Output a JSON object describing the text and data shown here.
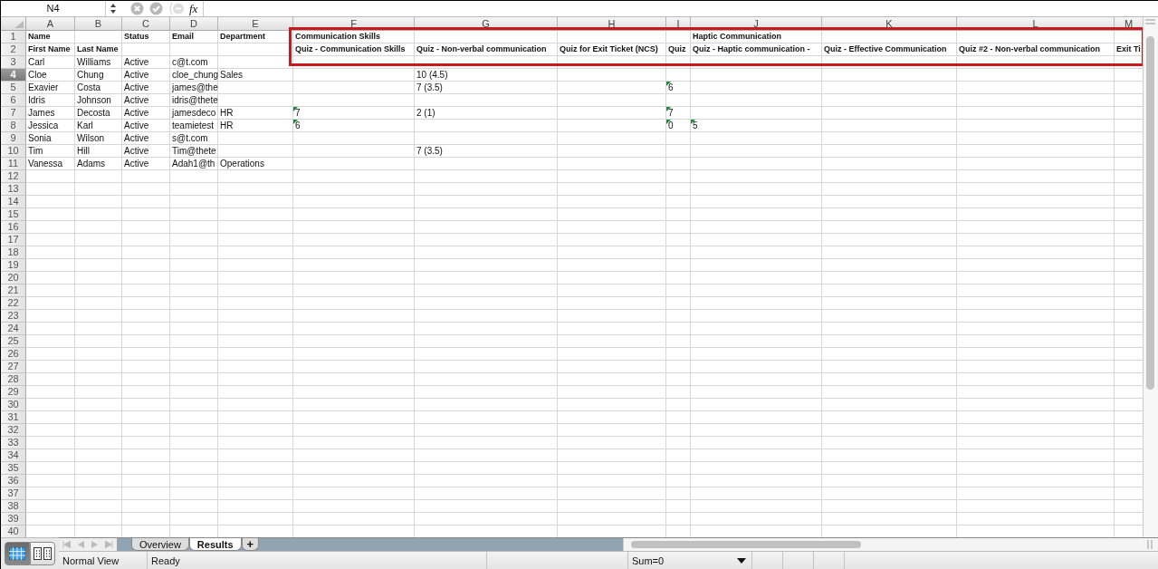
{
  "formula_bar": {
    "name_box": "N4",
    "fx": "fx"
  },
  "columns": [
    {
      "letter": "A"
    },
    {
      "letter": "B"
    },
    {
      "letter": "C"
    },
    {
      "letter": "D"
    },
    {
      "letter": "E"
    },
    {
      "letter": "F"
    },
    {
      "letter": "G"
    },
    {
      "letter": "H"
    },
    {
      "letter": "I"
    },
    {
      "letter": "J"
    },
    {
      "letter": "K"
    },
    {
      "letter": "L"
    },
    {
      "letter": "M"
    }
  ],
  "rows": [
    {
      "number": "1",
      "selected": false,
      "bold": true,
      "cells": {
        "A": {
          "text": "Name",
          "flagged": false
        },
        "C": {
          "text": "Status",
          "flagged": false
        },
        "D": {
          "text": "Email",
          "flagged": false
        },
        "E": {
          "text": "Department",
          "flagged": false
        },
        "F": {
          "text": "Communication Skills",
          "flagged": false
        },
        "J": {
          "text": "Haptic Communication",
          "flagged": false
        }
      }
    },
    {
      "number": "2",
      "selected": false,
      "bold": true,
      "cells": {
        "A": {
          "text": "First Name",
          "flagged": false
        },
        "B": {
          "text": "Last Name",
          "flagged": false
        },
        "F": {
          "text": "Quiz - Communication Skills",
          "flagged": false
        },
        "G": {
          "text": "Quiz - Non-verbal communication",
          "flagged": false
        },
        "H": {
          "text": "Quiz for Exit Ticket (NCS)",
          "flagged": false
        },
        "I": {
          "text": "Quiz",
          "flagged": false
        },
        "J": {
          "text": "Quiz - Haptic communication -",
          "flagged": false
        },
        "K": {
          "text": "Quiz - Effective Communication",
          "flagged": false
        },
        "L": {
          "text": "Quiz #2 - Non-verbal communication",
          "flagged": false
        },
        "M": {
          "text": "Exit Ti",
          "flagged": false
        }
      }
    },
    {
      "number": "3",
      "selected": false,
      "bold": false,
      "cells": {
        "A": {
          "text": "Carl",
          "flagged": false
        },
        "B": {
          "text": "Williams",
          "flagged": false
        },
        "C": {
          "text": "Active",
          "flagged": false
        },
        "D": {
          "text": "c@t.com",
          "flagged": false
        }
      }
    },
    {
      "number": "4",
      "selected": true,
      "bold": false,
      "cells": {
        "A": {
          "text": "Cloe",
          "flagged": false
        },
        "B": {
          "text": "Chung",
          "flagged": false
        },
        "C": {
          "text": "Active",
          "flagged": false
        },
        "D": {
          "text": "cloe_chung",
          "flagged": false
        },
        "E": {
          "text": "Sales",
          "flagged": false
        },
        "G": {
          "text": "10 (4.5)",
          "flagged": false
        }
      }
    },
    {
      "number": "5",
      "selected": false,
      "bold": false,
      "cells": {
        "A": {
          "text": "Exavier",
          "flagged": false
        },
        "B": {
          "text": "Costa",
          "flagged": false
        },
        "C": {
          "text": "Active",
          "flagged": false
        },
        "D": {
          "text": "james@the",
          "flagged": false
        },
        "G": {
          "text": "7 (3.5)",
          "flagged": false
        },
        "I": {
          "text": "6",
          "flagged": true
        }
      }
    },
    {
      "number": "6",
      "selected": false,
      "bold": false,
      "cells": {
        "A": {
          "text": "Idris",
          "flagged": false
        },
        "B": {
          "text": "Johnson",
          "flagged": false
        },
        "C": {
          "text": "Active",
          "flagged": false
        },
        "D": {
          "text": "idris@thete",
          "flagged": false
        }
      }
    },
    {
      "number": "7",
      "selected": false,
      "bold": false,
      "cells": {
        "A": {
          "text": "James",
          "flagged": false
        },
        "B": {
          "text": "Decosta",
          "flagged": false
        },
        "C": {
          "text": "Active",
          "flagged": false
        },
        "D": {
          "text": "jamesdeco",
          "flagged": false
        },
        "E": {
          "text": "HR",
          "flagged": false
        },
        "F": {
          "text": "7",
          "flagged": true
        },
        "G": {
          "text": "2 (1)",
          "flagged": false
        },
        "I": {
          "text": "7",
          "flagged": true
        }
      }
    },
    {
      "number": "8",
      "selected": false,
      "bold": false,
      "cells": {
        "A": {
          "text": "Jessica",
          "flagged": false
        },
        "B": {
          "text": "Karl",
          "flagged": false
        },
        "C": {
          "text": "Active",
          "flagged": false
        },
        "D": {
          "text": "teamietest",
          "flagged": false
        },
        "E": {
          "text": "HR",
          "flagged": false
        },
        "F": {
          "text": "6",
          "flagged": true
        },
        "I": {
          "text": "0",
          "flagged": true
        },
        "J": {
          "text": "5",
          "flagged": true
        }
      }
    },
    {
      "number": "9",
      "selected": false,
      "bold": false,
      "cells": {
        "A": {
          "text": "Sonia",
          "flagged": false
        },
        "B": {
          "text": "Wilson",
          "flagged": false
        },
        "C": {
          "text": "Active",
          "flagged": false
        },
        "D": {
          "text": "s@t.com",
          "flagged": false
        }
      }
    },
    {
      "number": "10",
      "selected": false,
      "bold": false,
      "cells": {
        "A": {
          "text": "Tim",
          "flagged": false
        },
        "B": {
          "text": "Hill",
          "flagged": false
        },
        "C": {
          "text": "Active",
          "flagged": false
        },
        "D": {
          "text": "Tim@thete",
          "flagged": false
        },
        "G": {
          "text": "7 (3.5)",
          "flagged": false
        }
      }
    },
    {
      "number": "11",
      "selected": false,
      "bold": false,
      "cells": {
        "A": {
          "text": "Vanessa",
          "flagged": false
        },
        "B": {
          "text": "Adams",
          "flagged": false
        },
        "C": {
          "text": "Active",
          "flagged": false
        },
        "D": {
          "text": "Adah1@th",
          "flagged": false
        },
        "E": {
          "text": "Operations",
          "flagged": false
        }
      }
    },
    {
      "number": "12",
      "selected": false
    },
    {
      "number": "13",
      "selected": false
    },
    {
      "number": "14",
      "selected": false
    },
    {
      "number": "15",
      "selected": false
    },
    {
      "number": "16",
      "selected": false
    },
    {
      "number": "17",
      "selected": false
    },
    {
      "number": "18",
      "selected": false
    },
    {
      "number": "19",
      "selected": false
    },
    {
      "number": "20",
      "selected": false
    },
    {
      "number": "21",
      "selected": false
    },
    {
      "number": "22",
      "selected": false
    },
    {
      "number": "23",
      "selected": false
    },
    {
      "number": "24",
      "selected": false
    },
    {
      "number": "25",
      "selected": false
    },
    {
      "number": "26",
      "selected": false
    },
    {
      "number": "27",
      "selected": false
    },
    {
      "number": "28",
      "selected": false
    },
    {
      "number": "29",
      "selected": false
    },
    {
      "number": "30",
      "selected": false
    },
    {
      "number": "31",
      "selected": false
    },
    {
      "number": "32",
      "selected": false
    },
    {
      "number": "33",
      "selected": false
    },
    {
      "number": "34",
      "selected": false
    },
    {
      "number": "35",
      "selected": false
    },
    {
      "number": "36",
      "selected": false
    },
    {
      "number": "37",
      "selected": false
    },
    {
      "number": "38",
      "selected": false
    },
    {
      "number": "39",
      "selected": false
    },
    {
      "number": "40",
      "selected": false
    }
  ],
  "views": [
    {
      "kind": "normal",
      "selected": true
    },
    {
      "kind": "page_layout",
      "selected": false
    }
  ],
  "sheet_tabs": [
    {
      "label": "Overview",
      "selected": false
    },
    {
      "label": "Results",
      "selected": true
    }
  ],
  "add_sheet": "+",
  "status_bar": {
    "view": "Normal View",
    "state": "Ready",
    "sum": "Sum=0"
  }
}
